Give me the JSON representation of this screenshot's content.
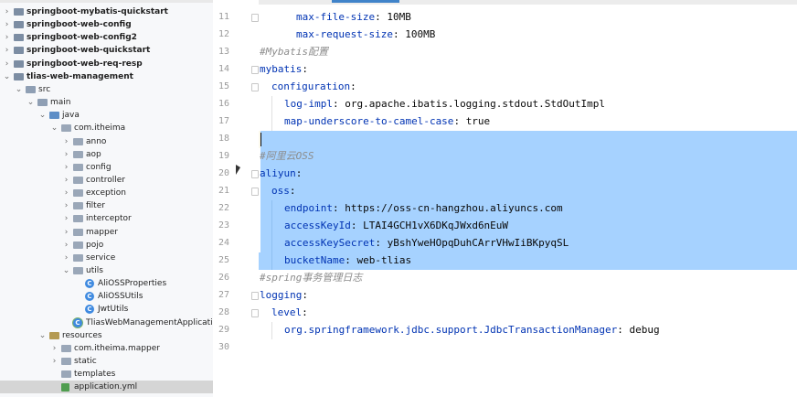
{
  "project_tree": {
    "items": [
      {
        "label": "springboot-mybatis-quickstart",
        "kind": "module",
        "bold": true
      },
      {
        "label": "springboot-web-config",
        "kind": "module",
        "bold": true
      },
      {
        "label": "springboot-web-config2",
        "kind": "module",
        "bold": true
      },
      {
        "label": "springboot-web-quickstart",
        "kind": "module",
        "bold": true
      },
      {
        "label": "springboot-web-req-resp",
        "kind": "module",
        "bold": true
      },
      {
        "label": "tlias-web-management",
        "kind": "module",
        "bold": true
      },
      {
        "label": "src",
        "kind": "folder"
      },
      {
        "label": "main",
        "kind": "folder"
      },
      {
        "label": "java",
        "kind": "srcfolder"
      },
      {
        "label": "com.itheima",
        "kind": "pkg"
      },
      {
        "label": "anno",
        "kind": "pkg"
      },
      {
        "label": "aop",
        "kind": "pkg"
      },
      {
        "label": "config",
        "kind": "pkg"
      },
      {
        "label": "controller",
        "kind": "pkg"
      },
      {
        "label": "exception",
        "kind": "pkg"
      },
      {
        "label": "filter",
        "kind": "pkg"
      },
      {
        "label": "interceptor",
        "kind": "pkg"
      },
      {
        "label": "mapper",
        "kind": "pkg"
      },
      {
        "label": "pojo",
        "kind": "pkg"
      },
      {
        "label": "service",
        "kind": "pkg"
      },
      {
        "label": "utils",
        "kind": "pkg"
      },
      {
        "label": "AliOSSProperties",
        "kind": "class"
      },
      {
        "label": "AliOSSUtils",
        "kind": "class"
      },
      {
        "label": "JwtUtils",
        "kind": "class"
      },
      {
        "label": "TliasWebManagementApplication",
        "kind": "mainclass"
      },
      {
        "label": "resources",
        "kind": "resfolder"
      },
      {
        "label": "com.itheima.mapper",
        "kind": "pkg"
      },
      {
        "label": "static",
        "kind": "pkg"
      },
      {
        "label": "templates",
        "kind": "pkg"
      },
      {
        "label": "application.yml",
        "kind": "yml"
      }
    ]
  },
  "editor": {
    "line_numbers": [
      "11",
      "12",
      "13",
      "14",
      "15",
      "16",
      "17",
      "18",
      "19",
      "20",
      "21",
      "22",
      "23",
      "24",
      "25",
      "26",
      "27",
      "28",
      "29",
      "30"
    ],
    "lines": {
      "l11": {
        "key": "max-file-size",
        "sep": ": ",
        "val": "10MB"
      },
      "l12": {
        "key": "max-request-size",
        "sep": ": ",
        "val": "100MB"
      },
      "l13": {
        "comment": "#Mybatis配置"
      },
      "l14": {
        "key": "mybatis",
        "sep": ":"
      },
      "l15": {
        "key": "configuration",
        "sep": ":"
      },
      "l16": {
        "key": "log-impl",
        "sep": ": ",
        "val": "org.apache.ibatis.logging.stdout.StdOutImpl"
      },
      "l17": {
        "key": "map-underscore-to-camel-case",
        "sep": ": ",
        "val": "true"
      },
      "l19": {
        "comment": "#阿里云OSS"
      },
      "l20": {
        "key": "aliyun",
        "sep": ":"
      },
      "l21": {
        "key": "oss",
        "sep": ":"
      },
      "l22": {
        "key": "endpoint",
        "sep": ": ",
        "val": "https://oss-cn-hangzhou.aliyuncs.com"
      },
      "l23": {
        "key": "accessKeyId",
        "sep": ": ",
        "val": "LTAI4GCH1vX6DKqJWxd6nEuW"
      },
      "l24": {
        "key": "accessKeySecret",
        "sep": ": ",
        "val": "yBshYweHOpqDuhCArrVHwIiBKpyqSL"
      },
      "l25": {
        "key": "bucketName",
        "sep": ": ",
        "val": "web-tlias"
      },
      "l26": {
        "comment": "#spring事务管理日志"
      },
      "l27": {
        "key": "logging",
        "sep": ":"
      },
      "l28": {
        "key": "level",
        "sep": ":"
      },
      "l29": {
        "key": "org.springframework.jdbc.support.JdbcTransactionManager",
        "sep": ": ",
        "val": "debug"
      }
    }
  },
  "colors": {
    "selection": "#a6d2ff",
    "key": "#0033b3",
    "comment": "#8c8c8c",
    "selected_row": "#d5d5d5"
  }
}
